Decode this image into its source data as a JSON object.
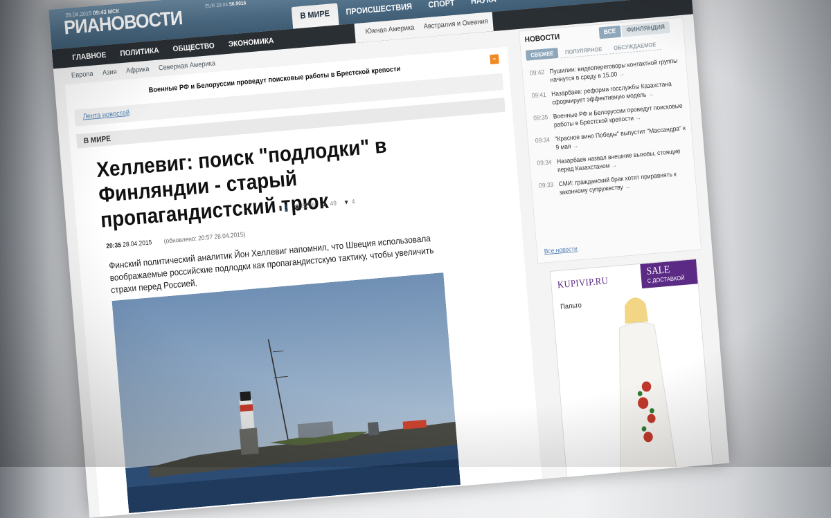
{
  "header": {
    "date": "29.04.2015",
    "time": "09:43 МСК",
    "logo_main": "РИА",
    "logo_accent": "НОВОСТИ",
    "rates_label": "EUR",
    "rates_date": "29.04",
    "rates_value": "56.9016",
    "top_tabs": [
      "В МИРЕ",
      "ПРОИСШЕСТВИЯ",
      "СПОРТ",
      "НАУКА"
    ],
    "media_controls": [
      "prev",
      "pause",
      "next"
    ]
  },
  "nav": {
    "items": [
      "ГЛАВНОЕ",
      "ПОЛИТИКА",
      "ОБЩЕСТВО",
      "ЭКОНОМИКА"
    ],
    "subregions": [
      "Южная Америка",
      "Австралия и Океания"
    ],
    "subnav": [
      "Европа",
      "Азия",
      "Африка",
      "Северная Америка"
    ]
  },
  "main": {
    "ticker_text": "Военные РФ и Белоруссии проведут поисковые работы в Брестской крепости",
    "lenta_link": "Лента новостей",
    "section": "В МИРЕ",
    "headline": "Хеллевиг: поиск \"подлодки\" в Финляндии - старый пропагандистский трюк",
    "time": "20:35",
    "date": "28.04.2015",
    "updated": "(обновлено: 20:57 28.04.2015)",
    "comments": "9",
    "views": "8278",
    "likes": "49",
    "dislikes": "4",
    "lead": "Финский политический аналитик Йон Хеллевиг напомнил, что Швеция использовала воображаемые российские подлодки как пропагандистскую тактику, чтобы увеличить страхи перед Россией."
  },
  "sidebar": {
    "title": "НОВОСТИ",
    "filter_all": "ВСЕ",
    "filter_fin": "ФИНЛЯНДИЯ",
    "tabs": [
      "СВЕЖЕЕ",
      "ПОПУЛЯРНОЕ",
      "ОБСУЖДАЕМОЕ"
    ],
    "items": [
      {
        "time": "09:42",
        "text": "Пушилин: видеопереговоры контактной группы начнутся в среду в 15.00"
      },
      {
        "time": "09:41",
        "text": "Назарбаев: реформа госслужбы Казахстана сформирует эффективную модель"
      },
      {
        "time": "09:35",
        "text": "Военные РФ и Белоруссии проведут поисковые работы в Брестской крепости"
      },
      {
        "time": "09:34",
        "text": "\"Красное вино Победы\" выпустит \"Массандра\" к 9 мая"
      },
      {
        "time": "09:34",
        "text": "Назарбаев назвал внешние вызовы, стоящие перед Казахстаном"
      },
      {
        "time": "09:33",
        "text": "СМИ: гражданский брак хотят приравнять к законному супружеству"
      }
    ],
    "all_news": "Все новости",
    "arrow": "→"
  },
  "ad": {
    "logo": "KUPIVIP.RU",
    "sale": "SALE",
    "sale_sub": "С ДОСТАВКОЙ",
    "item": "Пальто"
  }
}
